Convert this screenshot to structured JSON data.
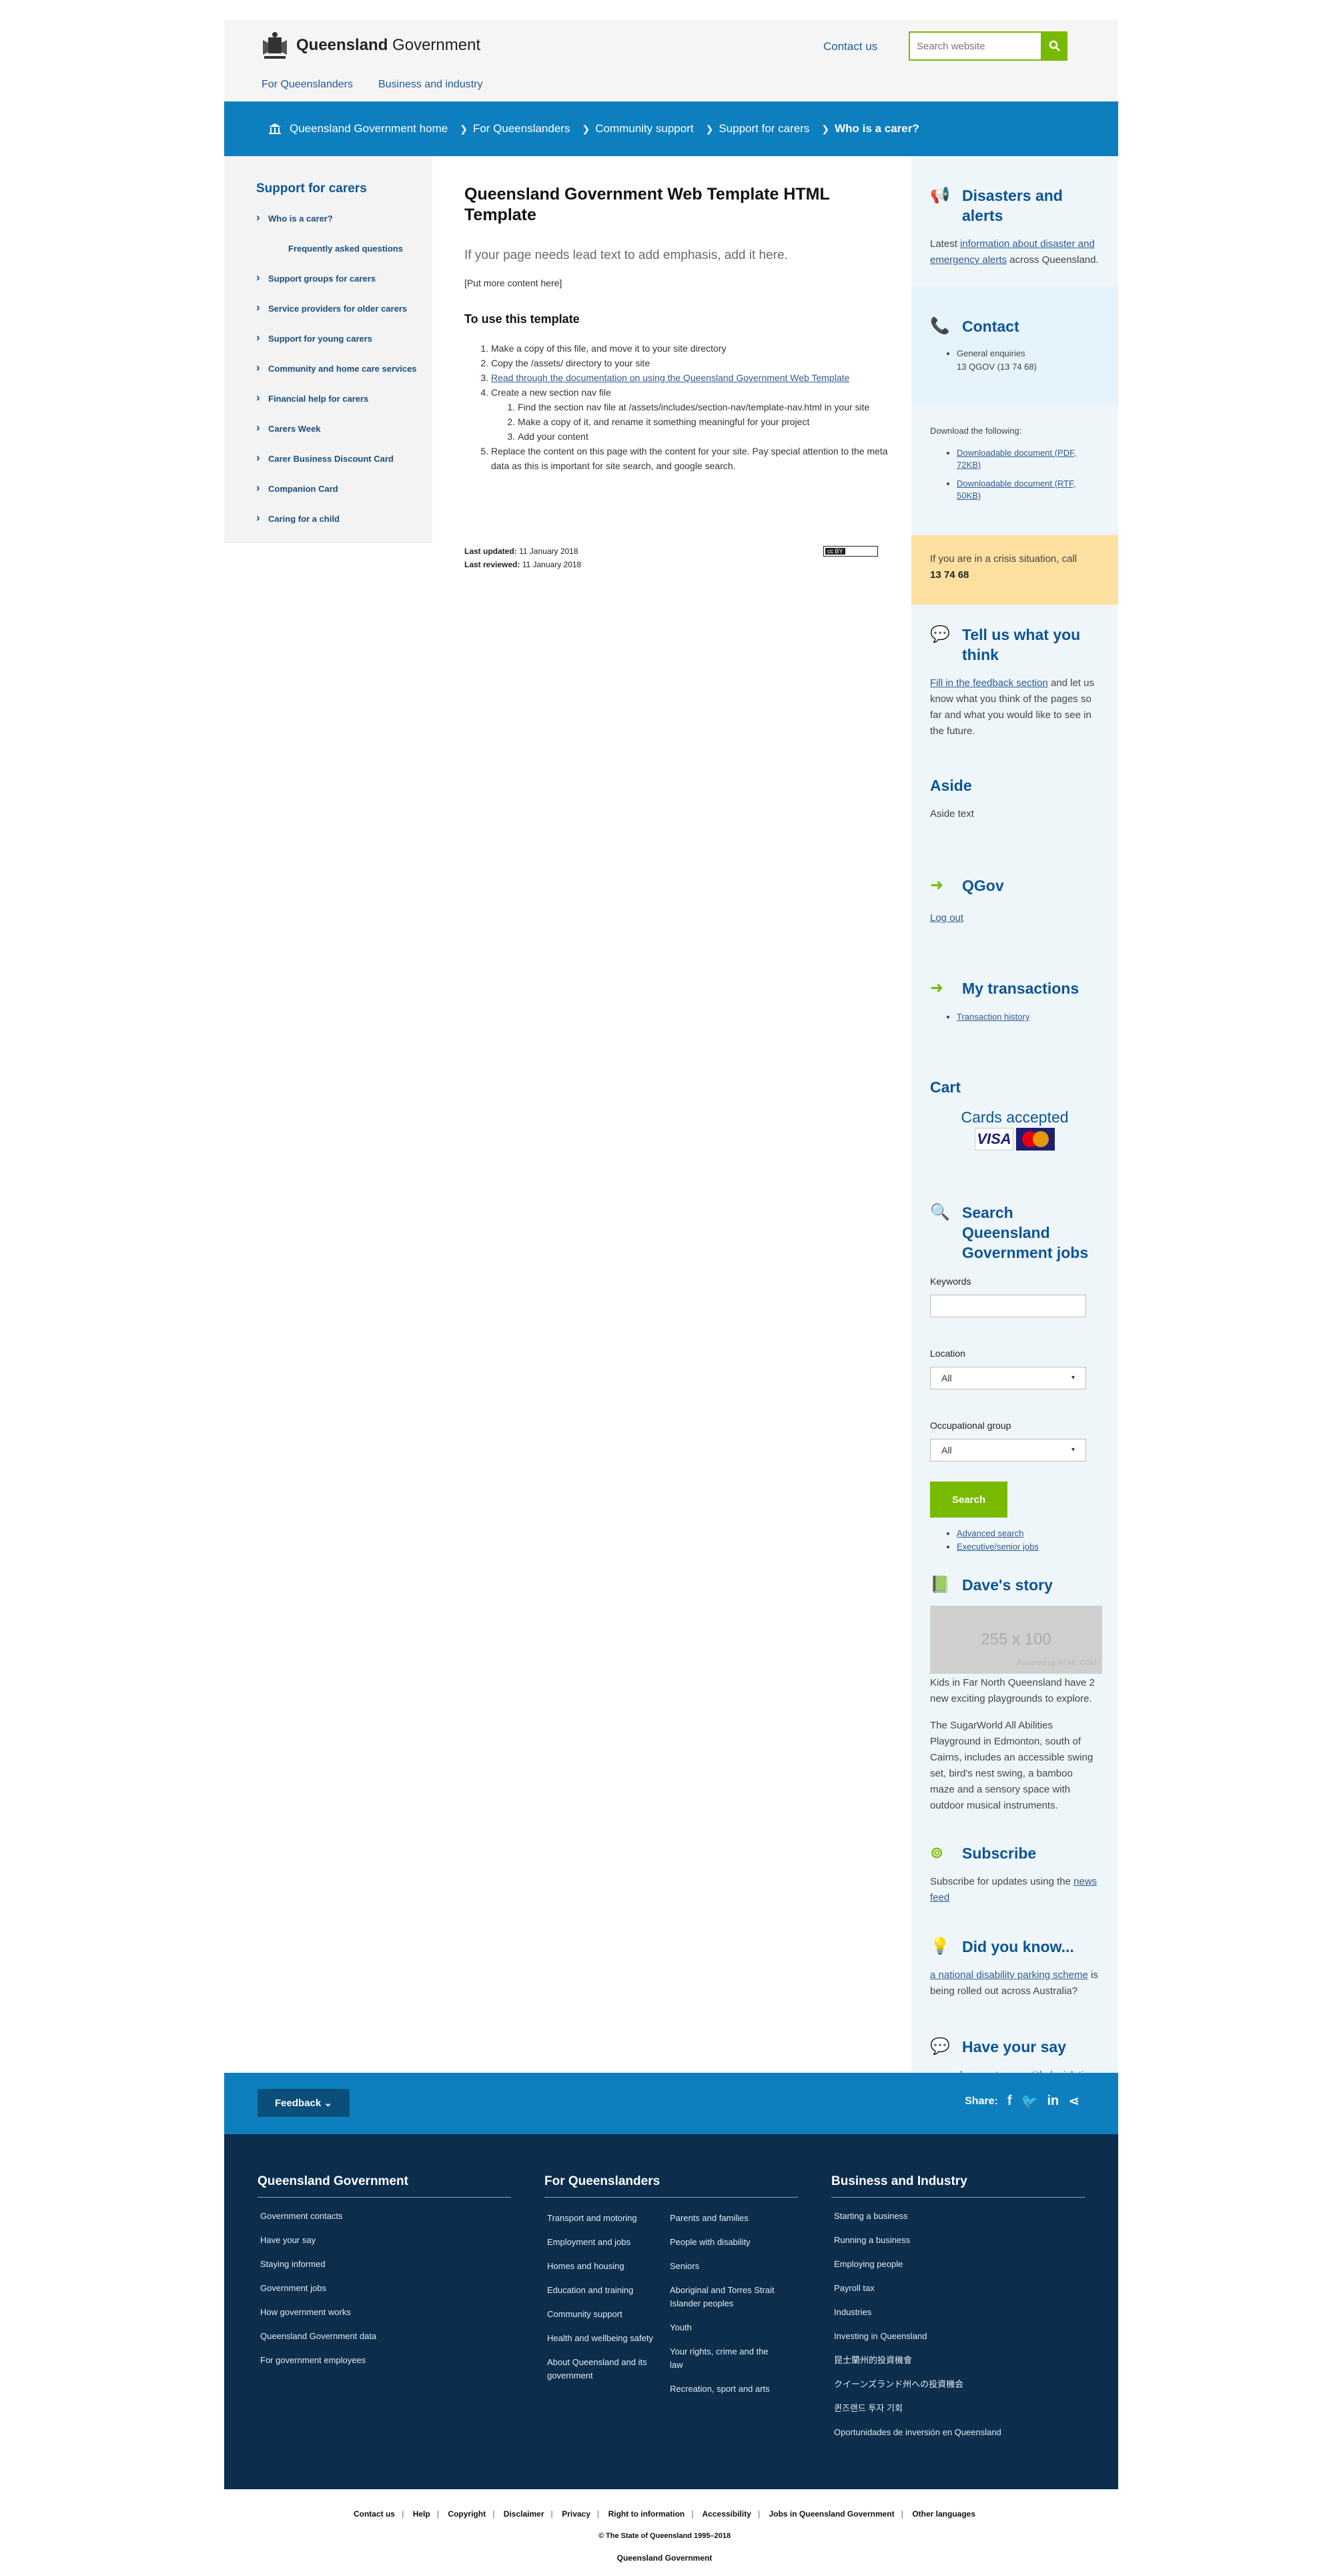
{
  "header": {
    "brand_prefix": "Queensland",
    "brand_suffix": "Government",
    "contact_link": "Contact us",
    "search_placeholder": "Search website",
    "nav": [
      "For Queenslanders",
      "Business and industry"
    ]
  },
  "breadcrumb": [
    "Queensland Government home",
    "For Queenslanders",
    "Community support",
    "Support for carers",
    "Who is a carer?"
  ],
  "leftnav": {
    "title": "Support for carers",
    "items": [
      "Who is a carer?",
      "Frequently asked questions",
      "Support groups for carers",
      "Service providers for older carers",
      "Support for young carers",
      "Community and home care services",
      "Financial help for carers",
      "Carers Week",
      "Carer Business Discount Card",
      "Companion Card",
      "Caring for a child"
    ]
  },
  "main": {
    "title": "Queensland Government Web Template HTML Template",
    "lead": "If your page needs lead text to add emphasis, add it here.",
    "more": "[Put more content here]",
    "subtitle": "To use this template",
    "steps": [
      "Make a copy of this file, and move it to your site directory",
      "Copy the /assets/ directory to your site",
      "Read through the documentation on using the Queensland Government Web Template",
      "Create a new section nav file",
      "Replace the content on this page with the content for your site. Pay special attention to the meta data as this is important for site search, and google search."
    ],
    "substeps": [
      "Find the section nav file at /assets/includes/section-nav/template-nav.html in your site",
      "Make a copy of it, and rename it something meaningful for your project",
      "Add your content"
    ],
    "updated_label": "Last updated:",
    "updated_value": "11 January 2018",
    "reviewed_label": "Last reviewed:",
    "reviewed_value": "11 January 2018",
    "cc_badge": "cc  BY"
  },
  "aside": {
    "disasters_title": "Disasters and alerts",
    "disasters_pre": "Latest",
    "disasters_link": "information about disaster and emergency alerts",
    "disasters_post": "across Queensland.",
    "contact_title": "Contact",
    "contact_item1": "General enquiries",
    "contact_item2": "13 QGOV (13 74 68)",
    "download_intro": "Download the following:",
    "download_1": "Downloadable document (PDF, 72KB)",
    "download_2": "Downloadable document (RTF, 50KB)",
    "crisis_text": "If you are in a crisis situation, call",
    "crisis_number": "13 74 68",
    "tell_title": "Tell us what you think",
    "tell_link": "Fill in the feedback section",
    "tell_text": "and let us know what you think of the pages so far and what you would like to see in the future.",
    "aside_title": "Aside",
    "aside_text": "Aside text",
    "qgov_title": "QGov",
    "qgov_link": "Log out",
    "trans_title": "My transactions",
    "trans_link": "Transaction history",
    "cart_title": "Cart",
    "cards_title": "Cards accepted",
    "card_visa": "VISA",
    "jobs_title": "Search Queensland Government jobs",
    "keywords_label": "Keywords",
    "location_label": "Location",
    "location_value": "All",
    "occ_label": "Occupational group",
    "occ_value": "All",
    "search_btn": "Search",
    "adv_link": "Advanced search",
    "exec_link": "Executive/senior jobs",
    "dave_title": "Dave's story",
    "img_label": "255 x 100",
    "img_credit": "Powered by HTML.COM",
    "dave_p1": "Kids in Far North Queensland have 2 new exciting playgrounds to explore.",
    "dave_p2": "The SugarWorld All Abilities Playground in Edmonton, south of Cairns, includes an accessible swing set, bird's nest swing, a bamboo maze and a sensory space with outdoor musical instruments.",
    "sub_title": "Subscribe",
    "sub_text": "Subscribe for updates using the",
    "sub_link": "news feed",
    "dyk_title": "Did you know...",
    "dyk_link": "a national disability parking scheme",
    "dyk_text": "is being rolled out across Australia?",
    "say_title": "Have your say",
    "say_pre": "... on",
    "say_link": "changes to page title legislation",
    "say_post": "."
  },
  "feedback": {
    "button": "Feedback",
    "share": "Share:"
  },
  "footer": {
    "col1_title": "Queensland Government",
    "col1": [
      "Government contacts",
      "Have your say",
      "Staying informed",
      "Government jobs",
      "How government works",
      "Queensland Government data",
      "For government employees"
    ],
    "col2_title": "For Queenslanders",
    "col2a": [
      "Transport and motoring",
      "Employment and jobs",
      "Homes and housing",
      "Education and training",
      "Community support",
      "Health and wellbeing safety",
      "About Queensland and its government"
    ],
    "col2b": [
      "Parents and families",
      "People with disability",
      "Seniors",
      "Aboriginal and Torres Strait Islander peoples",
      "Youth",
      "Your rights, crime and the law",
      "Recreation, sport and arts"
    ],
    "col3_title": "Business and Industry",
    "col3": [
      "Starting a business",
      "Running a business",
      "Employing people",
      "Payroll tax",
      "Industries",
      "Investing in Queensland",
      "昆士蘭州的投資機會",
      "クイーンズランド州への投資機会",
      "퀸즈랜드 투자 기회",
      "Oportunidades de inversión en Queensland"
    ]
  },
  "bottom": {
    "links": [
      "Contact us",
      "Help",
      "Copyright",
      "Disclaimer",
      "Privacy",
      "Right to information",
      "Accessibility",
      "Jobs in Queensland Government",
      "Other languages"
    ],
    "copyright": "© The State of Queensland 1995–2018",
    "org": "Queensland Government"
  },
  "colors": {
    "accent": "#78ba00",
    "brand_blue": "#0d7fbf",
    "footer_bg": "#0c2d4c"
  },
  "icons": [
    "search-icon",
    "home-icon",
    "megaphone-icon",
    "phone-icon",
    "speech-bubbles-icon",
    "sign-in-icon",
    "search-icon",
    "book-icon",
    "rss-icon",
    "lightbulb-icon",
    "comment-icon",
    "chevron-down-icon",
    "facebook-icon",
    "twitter-icon",
    "linkedin-icon",
    "share-icon"
  ]
}
